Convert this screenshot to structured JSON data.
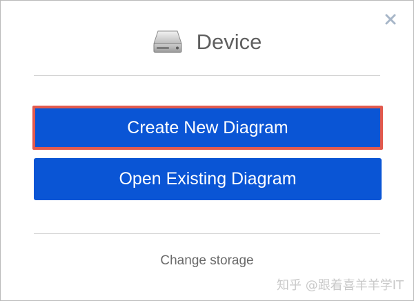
{
  "dialog": {
    "close_icon": "close-icon",
    "title": "Device",
    "title_icon": "hard-drive-icon",
    "create_button_label": "Create New Diagram",
    "open_button_label": "Open Existing Diagram",
    "change_storage_label": "Change storage",
    "colors": {
      "button_blue": "#0a55d5",
      "highlight_red": "#e25a4e",
      "close_gray_blue": "#a7b6c8"
    }
  },
  "watermark": {
    "text": "知乎 @跟着喜羊羊学IT"
  }
}
